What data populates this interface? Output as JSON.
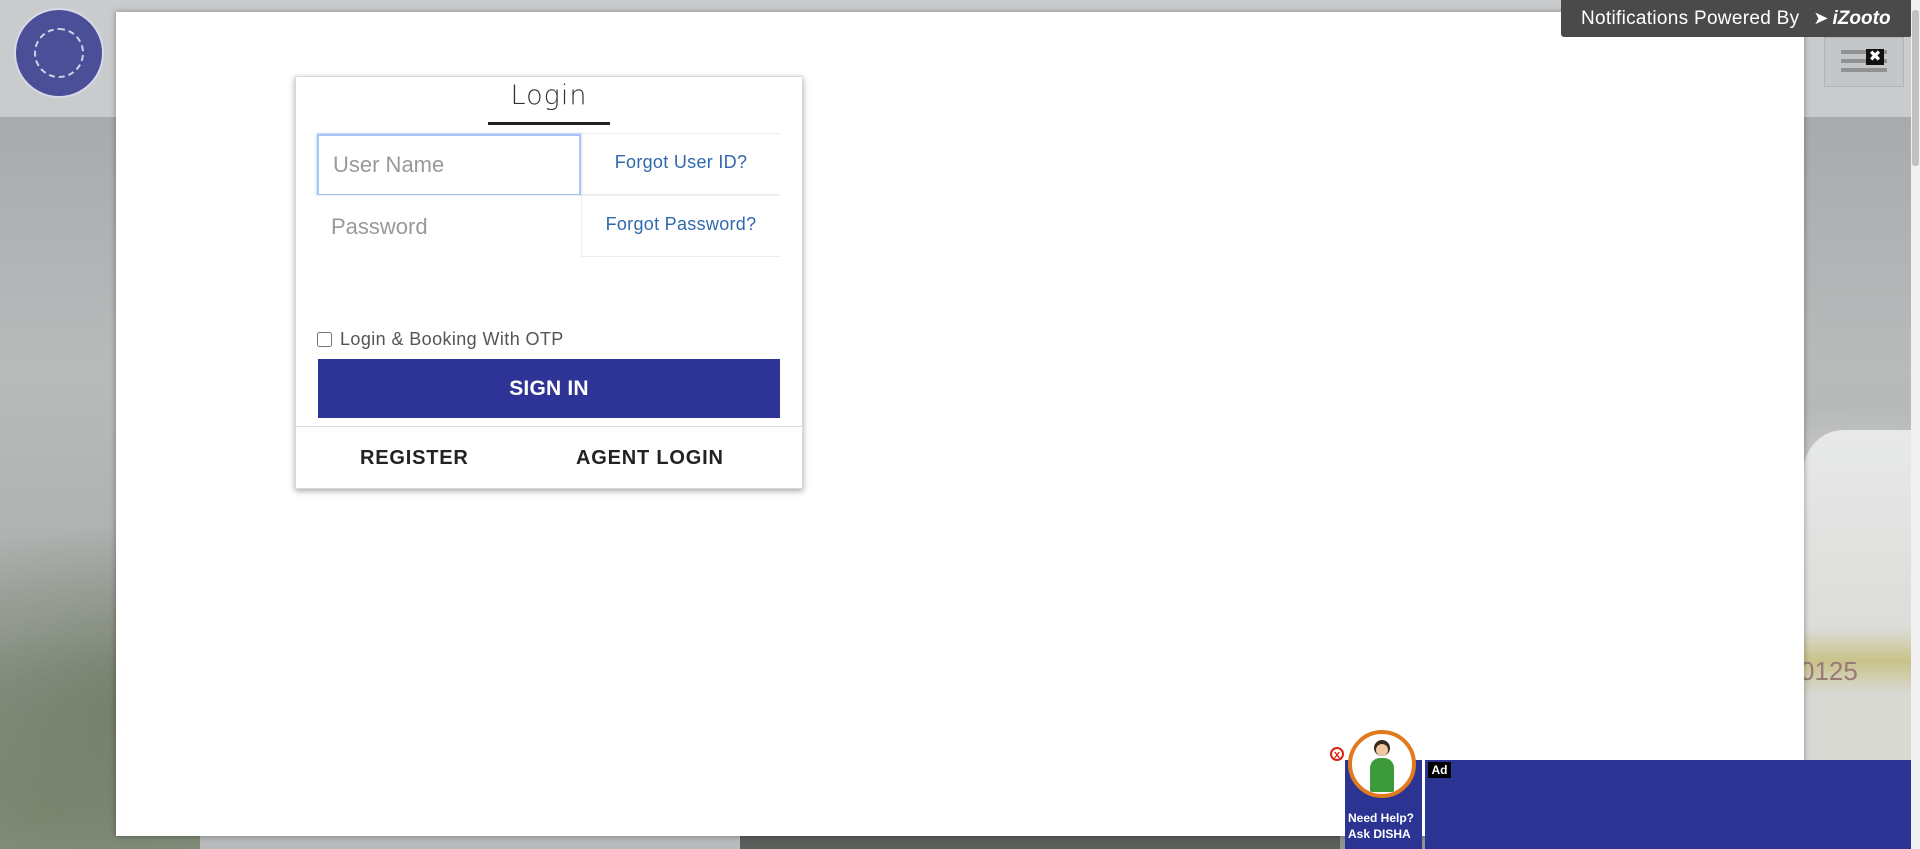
{
  "background": {
    "train_number": "0125"
  },
  "login": {
    "tab_label": "Login",
    "username_placeholder": "User Name",
    "password_placeholder": "Password",
    "forgot_user_id": "Forgot User ID?",
    "forgot_password": "Forgot Password?",
    "otp_label": "Login & Booking With OTP",
    "otp_checked": false,
    "sign_in_label": "SIGN IN",
    "register_label": "REGISTER",
    "agent_login_label": "AGENT LOGIN",
    "accent_color": "#2d3495"
  },
  "modal": {
    "close_symbol": "✖"
  },
  "notification_bar": {
    "text": "Notifications Powered By",
    "brand": "iZooto"
  },
  "disha": {
    "close_symbol": "x",
    "line1": "Need Help?",
    "line2": "Ask DISHA"
  },
  "ad": {
    "label": "Ad"
  }
}
